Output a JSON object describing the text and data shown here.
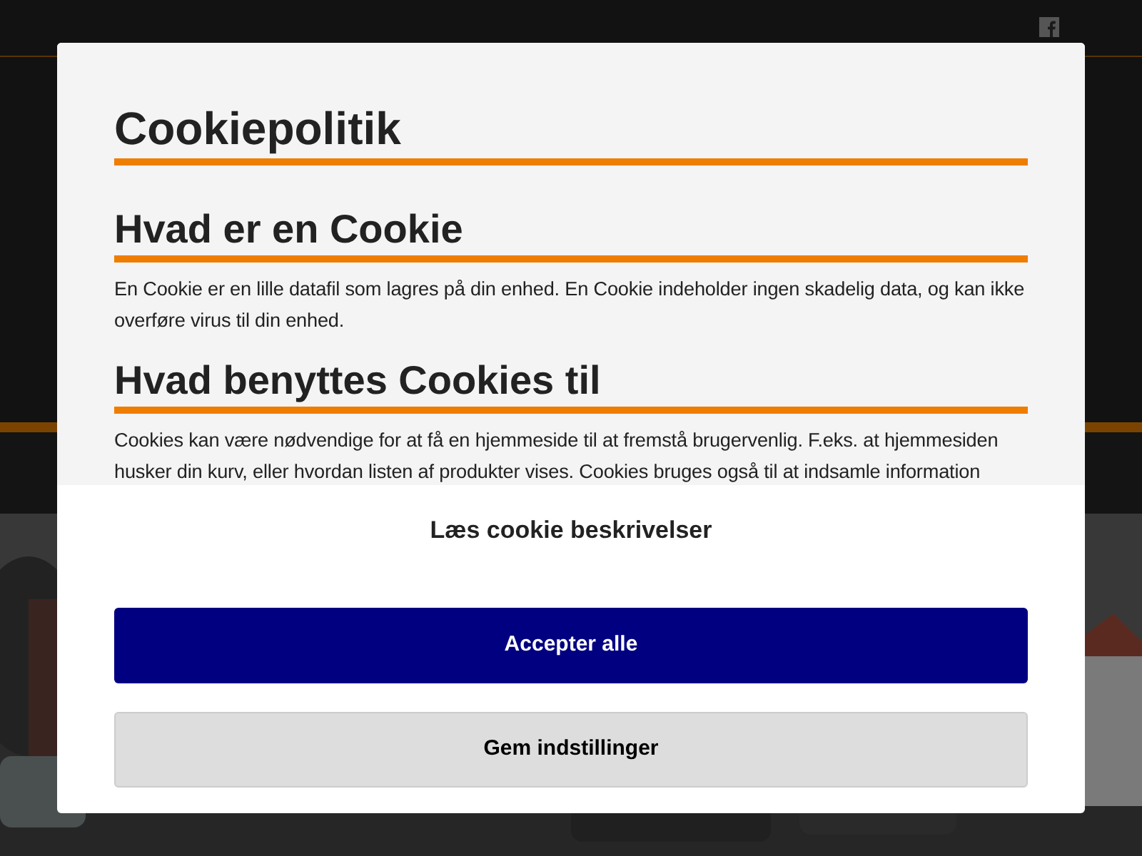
{
  "dialog": {
    "title": "Cookiepolitik",
    "sections": [
      {
        "heading": "Hvad er en Cookie",
        "text": "En Cookie er en lille datafil som lagres på din enhed. En Cookie indeholder ingen skadelig data, og kan ikke overføre virus til din enhed."
      },
      {
        "heading": "Hvad benyttes Cookies til",
        "text": "Cookies kan være nødvendige for at få en hjemmeside til at fremstå brugervenlig. F.eks. at hjemmesiden husker din kurv, eller hvordan listen af produkter vises. Cookies bruges også til at indsamle information"
      }
    ],
    "link": "Læs cookie beskrivelser",
    "buttons": [
      {
        "label": "Accepter alle",
        "kind": "primary"
      },
      {
        "label": "Gem indstillinger",
        "kind": "secondary"
      }
    ]
  }
}
